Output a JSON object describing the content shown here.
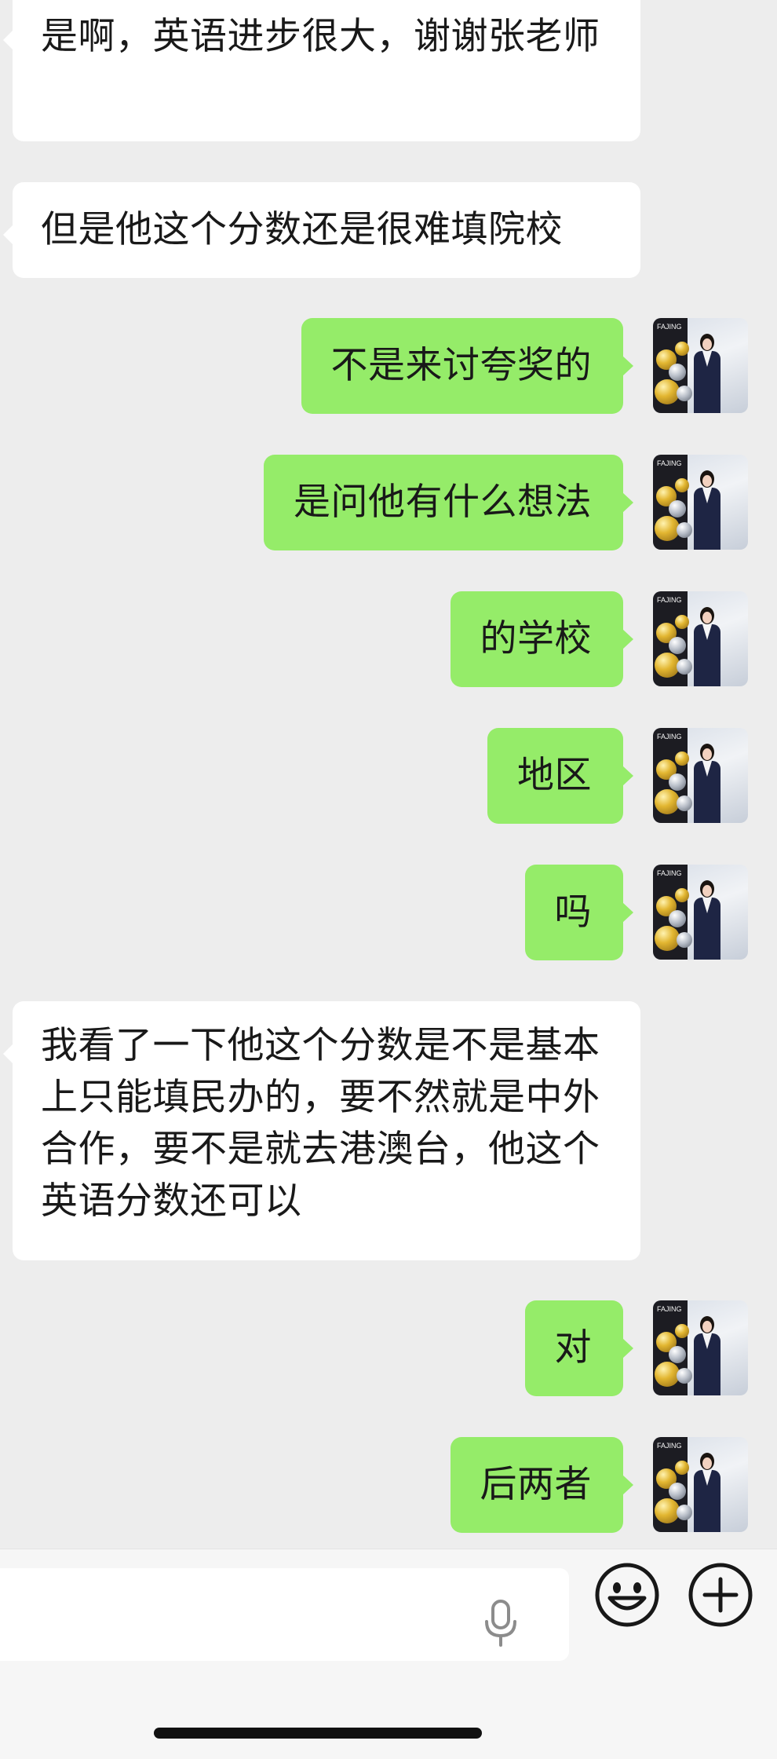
{
  "messages": [
    {
      "side": "left",
      "text": "是啊，英语进步很大，谢谢张老师"
    },
    {
      "side": "left",
      "text": "但是他这个分数还是很难填院校"
    },
    {
      "side": "right",
      "text": "不是来讨夸奖的"
    },
    {
      "side": "right",
      "text": "是问他有什么想法"
    },
    {
      "side": "right",
      "text": "的学校"
    },
    {
      "side": "right",
      "text": "地区"
    },
    {
      "side": "right",
      "text": "吗"
    },
    {
      "side": "left",
      "text": "我看了一下他这个分数是不是基本上只能填民办的，要不然就是中外合作，要不是就去港澳台，他这个英语分数还可以"
    },
    {
      "side": "right",
      "text": "对"
    },
    {
      "side": "right",
      "text": "后两者"
    }
  ],
  "colors": {
    "background": "#ededed",
    "bubble_self": "#95ec69",
    "bubble_other": "#ffffff",
    "text": "#191919"
  },
  "input_bar": {
    "icons": [
      "mic-icon",
      "emoji-icon",
      "plus-icon"
    ]
  }
}
